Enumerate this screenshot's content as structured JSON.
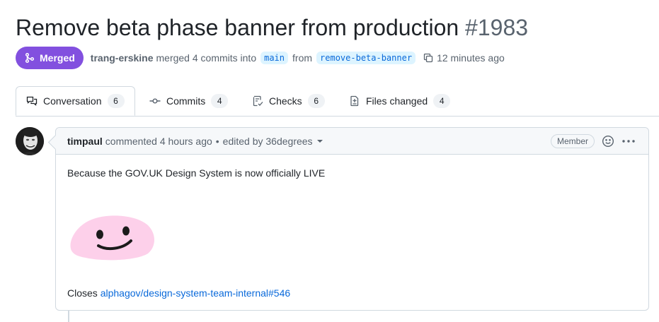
{
  "pr": {
    "title": "Remove beta phase banner from production",
    "number": "#1983",
    "status": "Merged",
    "author": "trang-erskine",
    "merged_text": "merged 4 commits into",
    "base_branch": "main",
    "from_text": "from",
    "head_branch": "remove-beta-banner",
    "time": "12 minutes ago"
  },
  "tabs": [
    {
      "label": "Conversation",
      "count": "6",
      "icon": "comment-discussion-icon"
    },
    {
      "label": "Commits",
      "count": "4",
      "icon": "git-commit-icon"
    },
    {
      "label": "Checks",
      "count": "6",
      "icon": "checklist-icon"
    },
    {
      "label": "Files changed",
      "count": "4",
      "icon": "file-diff-icon"
    }
  ],
  "comment": {
    "author": "timpaul",
    "action": "commented 4 hours ago",
    "separator": "•",
    "edited": "edited by 36degrees",
    "role": "Member",
    "body": "Because the GOV.UK Design System is now officially LIVE",
    "closes_label": "Closes",
    "closes_link": "alphagov/design-system-team-internal#546"
  },
  "colors": {
    "merged": "#8250df",
    "link": "#0969da",
    "blob": "#fdd0ea"
  }
}
